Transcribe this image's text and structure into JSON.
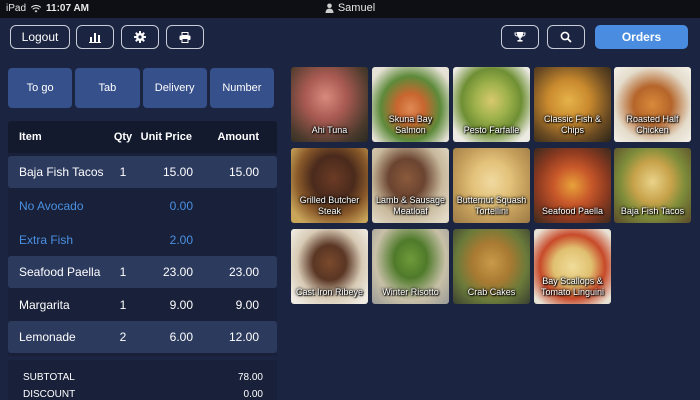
{
  "status_bar": {
    "device": "iPad",
    "time": "11:07 AM",
    "user": "Samuel"
  },
  "toolbar": {
    "logout_label": "Logout",
    "orders_label": "Orders",
    "icons": [
      "bar-chart-icon",
      "gear-icon",
      "printer-icon",
      "trophy-icon",
      "search-icon"
    ]
  },
  "order_types": [
    "To go",
    "Tab",
    "Delivery",
    "Number"
  ],
  "ticket": {
    "columns": {
      "item": "Item",
      "qty": "Qty",
      "unit": "Unit Price",
      "amount": "Amount"
    },
    "rows": [
      {
        "item": "Baja Fish Tacos",
        "qty": "1",
        "unit": "15.00",
        "amount": "15.00"
      },
      {
        "item": "No Avocado",
        "unit": "0.00"
      },
      {
        "item": "Extra Fish",
        "unit": "2.00"
      },
      {
        "item": "Seafood Paella",
        "qty": "1",
        "unit": "23.00",
        "amount": "23.00"
      },
      {
        "item": "Margarita",
        "qty": "1",
        "unit": "9.00",
        "amount": "9.00"
      },
      {
        "item": "Lemonade",
        "qty": "2",
        "unit": "6.00",
        "amount": "12.00"
      }
    ]
  },
  "totals": {
    "subtotal_label": "SUBTOTAL",
    "subtotal": "78.00",
    "discount_label": "DISCOUNT",
    "discount": "0.00"
  },
  "menu": {
    "items": [
      {
        "label": "Ahi Tuna"
      },
      {
        "label": "Skuna Bay Salmon"
      },
      {
        "label": "Pesto Farfalle"
      },
      {
        "label": "Classic Fish & Chips"
      },
      {
        "label": "Roasted Half Chicken"
      },
      {
        "label": "Grilled Butcher Steak"
      },
      {
        "label": "Lamb & Sausage Meatloaf"
      },
      {
        "label": "Butternut Squash Tortellini"
      },
      {
        "label": "Seafood Paella"
      },
      {
        "label": "Baja Fish Tacos"
      },
      {
        "label": "Cast Iron Ribeye"
      },
      {
        "label": "Winter Risotto"
      },
      {
        "label": "Crab Cakes"
      },
      {
        "label": "Bay Scallops & Tomato Linguini"
      }
    ]
  },
  "colors": {
    "background": "#1b2440",
    "accent": "#4a8de0",
    "modifier_text": "#4a90e2",
    "tab_fill": "#36508c"
  }
}
